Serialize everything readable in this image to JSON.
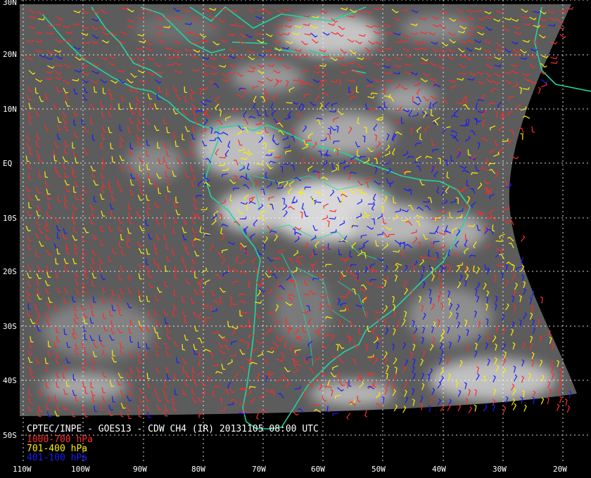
{
  "title": "CPTEC/INPE - GOES13 - CDW CH4 (IR) 20131105 08:00 UTC",
  "legend": [
    {
      "label": "1000-700 hPa",
      "color": "#ff2a2a"
    },
    {
      "label": "701-400 hPa",
      "color": "#ffee00"
    },
    {
      "label": "401-100 hPa",
      "color": "#1a1aff"
    }
  ],
  "lat_labels": [
    "30N",
    "20N",
    "10N",
    "EQ",
    "10S",
    "20S",
    "30S",
    "40S",
    "50S"
  ],
  "lon_labels": [
    "110W",
    "100W",
    "90W",
    "80W",
    "70W",
    "60W",
    "50W",
    "40W",
    "30W",
    "20W"
  ],
  "colors": {
    "background": "#000000",
    "coastline": "#22d4a0",
    "grid": "#ffffff"
  }
}
